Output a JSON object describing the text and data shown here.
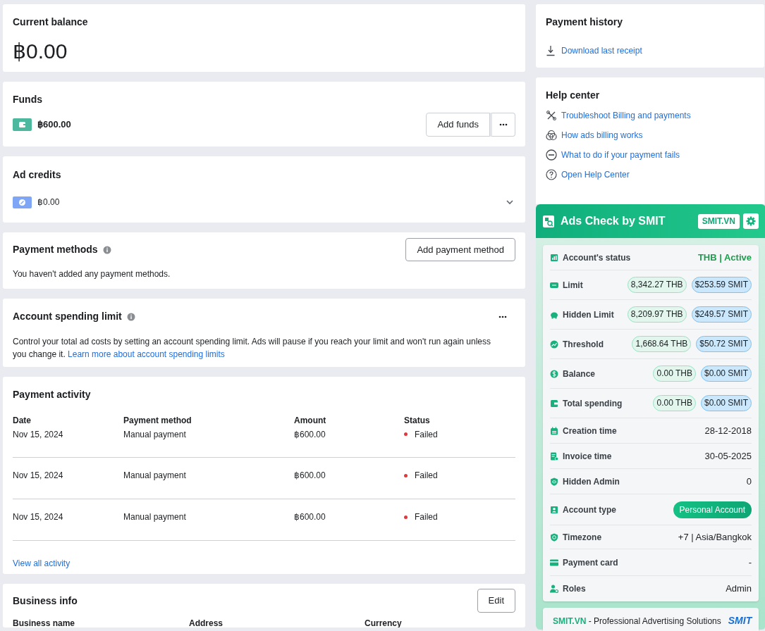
{
  "balance": {
    "title": "Current balance",
    "amount": "฿0.00"
  },
  "funds": {
    "title": "Funds",
    "amount": "฿600.00",
    "button": "Add funds"
  },
  "ad_credits": {
    "title": "Ad credits",
    "amount": "฿0.00",
    "expanded": false
  },
  "payment_methods": {
    "title": "Payment methods",
    "button": "Add payment method",
    "message": "You haven't added any payment methods."
  },
  "spending_limit": {
    "title": "Account spending limit",
    "description": "Control your total ad costs by setting an account spending limit. Ads will pause if you reach your limit and won't run again unless you change it.",
    "link": "Learn more about account spending limits"
  },
  "payment_activity": {
    "title": "Payment activity",
    "columns": [
      "Date",
      "Payment method",
      "Amount",
      "Status"
    ],
    "rows": [
      {
        "date": "Nov 15, 2024",
        "method": "Manual payment",
        "amount": "฿600.00",
        "status": "Failed",
        "color": "#e0383e"
      },
      {
        "date": "Nov 15, 2024",
        "method": "Manual payment",
        "amount": "฿600.00",
        "status": "Failed",
        "color": "#e0383e"
      },
      {
        "date": "Nov 15, 2024",
        "method": "Manual payment",
        "amount": "฿600.00",
        "status": "Failed",
        "color": "#e0383e"
      }
    ],
    "link": "View all activity"
  },
  "business_info": {
    "title": "Business info",
    "button": "Edit",
    "columns": [
      "Business name",
      "Address",
      "Currency"
    ]
  },
  "payment_history": {
    "title": "Payment history",
    "link": "Download last receipt"
  },
  "help_center": {
    "title": "Help center",
    "links": [
      "Troubleshoot Billing and payments",
      "How ads billing works",
      "What to do if your payment fails",
      "Open Help Center"
    ]
  },
  "ads_check": {
    "title": "Ads Check by SMIT",
    "badge": "SMIT.VN",
    "rows": [
      {
        "kind": "status",
        "label": "Account's status",
        "value": "THB | Active"
      },
      {
        "kind": "pills",
        "label": "Limit",
        "values": [
          "8,342.27 THB",
          "$253.59 SMIT"
        ]
      },
      {
        "kind": "pills",
        "label": "Hidden Limit",
        "values": [
          "8,209.97 THB",
          "$249.57 SMIT"
        ]
      },
      {
        "kind": "pills",
        "label": "Threshold",
        "values": [
          "1,668.64 THB",
          "$50.72 SMIT"
        ]
      },
      {
        "kind": "pills",
        "label": "Balance",
        "values": [
          "0.00 THB",
          "$0.00 SMIT"
        ]
      },
      {
        "kind": "pills",
        "label": "Total spending",
        "values": [
          "0.00 THB",
          "$0.00 SMIT"
        ]
      },
      {
        "kind": "text",
        "label": "Creation time",
        "value": "28-12-2018"
      },
      {
        "kind": "text",
        "label": "Invoice time",
        "value": "30-05-2025"
      },
      {
        "kind": "text",
        "label": "Hidden Admin",
        "value": "0"
      },
      {
        "kind": "badge",
        "label": "Account type",
        "value": "Personal Account"
      },
      {
        "kind": "text",
        "label": "Timezone",
        "value": "+7 | Asia/Bangkok"
      },
      {
        "kind": "text",
        "label": "Payment card",
        "value": "-"
      },
      {
        "kind": "text",
        "label": "Roles",
        "value": "Admin"
      }
    ],
    "footer": {
      "brand": "SMIT.VN",
      "text": " - Professional Advertising Solutions",
      "logo": "SMIT"
    }
  }
}
